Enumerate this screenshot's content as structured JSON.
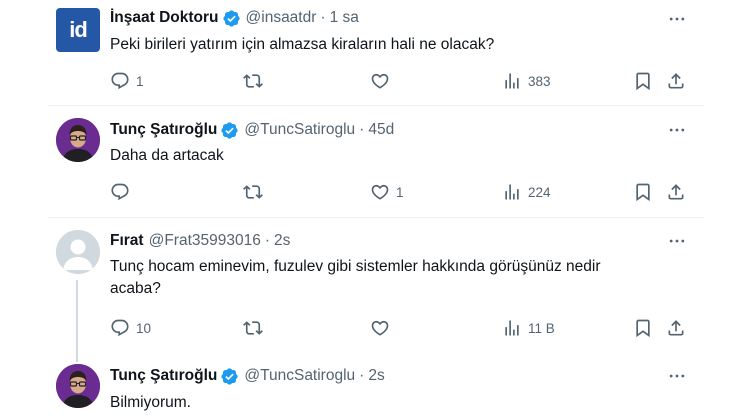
{
  "tweets": [
    {
      "name": "İnşaat Doktoru",
      "handle": "@insaatdr",
      "time": "1 sa",
      "text": "Peki birileri yatırım için almazsa kiraların hali ne olacak?",
      "avatar_text": "id",
      "reply_count": "1",
      "retweet_count": "",
      "like_count": "",
      "view_count": "383"
    },
    {
      "name": "Tunç Şatıroğlu",
      "handle": "@TuncSatiroglu",
      "time": "45d",
      "text": "Daha da artacak",
      "reply_count": "",
      "retweet_count": "",
      "like_count": "1",
      "view_count": "224"
    },
    {
      "name": "Fırat",
      "handle": "@Frat35993016",
      "time": "2s",
      "text_line1": "Tunç hocam eminevim, fuzulev gibi sistemler hakkında görüşünüz nedir",
      "text_line2": "acaba?",
      "reply_count": "10",
      "retweet_count": "",
      "like_count": "",
      "view_count": "11 B"
    },
    {
      "name": "Tunç Şatıroğlu",
      "handle": "@TuncSatiroglu",
      "time": "2s",
      "text": "Bilmiyorum."
    }
  ],
  "separator": "·",
  "colors": {
    "verified_blue": "#1d9bf0",
    "secondary_text": "#536471",
    "indeed_blue": "#2557a7",
    "thread_line": "#cfd9de"
  },
  "icons": [
    "verified-badge-icon",
    "more-icon",
    "reply-icon",
    "retweet-icon",
    "like-icon",
    "views-icon",
    "bookmark-icon",
    "share-icon"
  ]
}
